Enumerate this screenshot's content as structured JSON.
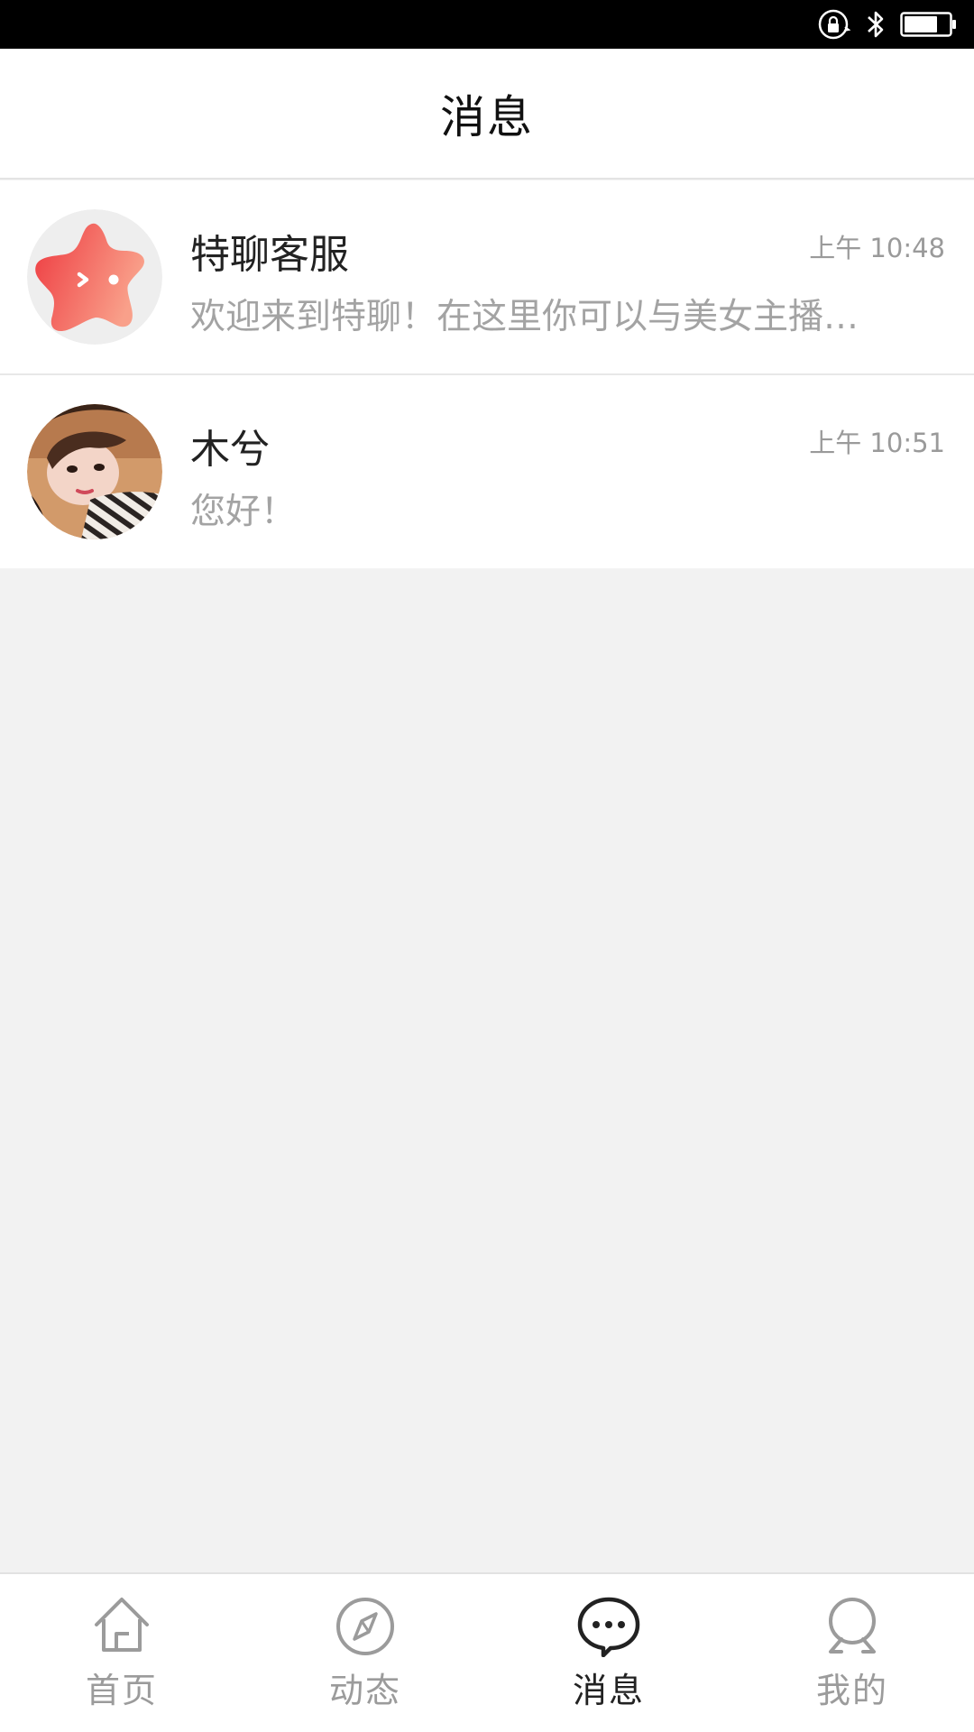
{
  "status_bar": {
    "icons": [
      "rotation-lock-icon",
      "bluetooth-icon",
      "battery-icon"
    ],
    "battery_level": 0.75
  },
  "header": {
    "title": "消息"
  },
  "conversations": [
    {
      "avatar": "star-mascot-avatar",
      "name": "特聊客服",
      "time": "上午 10:48",
      "preview": "欢迎来到特聊！在这里你可以与美女主播一..."
    },
    {
      "avatar": "user-photo-avatar",
      "name": "木兮",
      "time": "上午 10:51",
      "preview": "您好！"
    }
  ],
  "tab_bar": {
    "tabs": [
      {
        "label": "首页",
        "icon": "home-icon",
        "active": false
      },
      {
        "label": "动态",
        "icon": "compass-icon",
        "active": false
      },
      {
        "label": "消息",
        "icon": "chat-bubble-icon",
        "active": true
      },
      {
        "label": "我的",
        "icon": "profile-icon",
        "active": false
      }
    ]
  },
  "colors": {
    "accent_red": "#f0454a",
    "text_primary": "#222222",
    "text_secondary": "#a3a3a3",
    "background": "#f2f2f2"
  }
}
